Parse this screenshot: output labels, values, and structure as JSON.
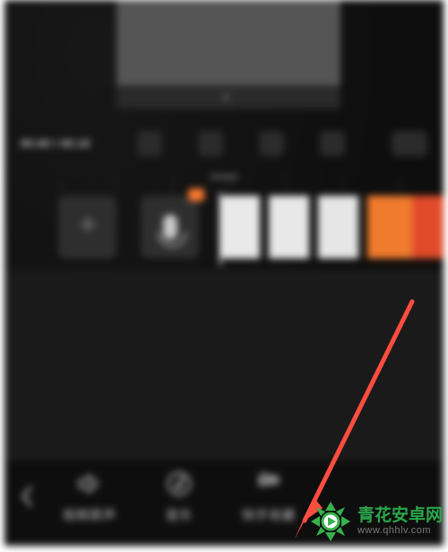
{
  "preview": {
    "caption": ""
  },
  "player": {
    "time_display": "00:00 / 00:15"
  },
  "timeline": {
    "add_label": "",
    "mic_label": "",
    "mic_badge": ""
  },
  "annotation": {
    "arrow_color": "#ff4d40"
  },
  "toolbar": {
    "back_label": "返回",
    "items": [
      {
        "id": "original-sound",
        "label": "视频原声",
        "icon": "speaker-icon"
      },
      {
        "id": "music",
        "label": "音乐",
        "icon": "music-note-icon"
      },
      {
        "id": "ks-favorites",
        "label": "快手收藏",
        "icon": "kuaishou-icon"
      }
    ]
  },
  "watermark": {
    "brand": "青花安卓网",
    "url": "www.qhhlv.com",
    "logo_color": "#37b24d"
  }
}
